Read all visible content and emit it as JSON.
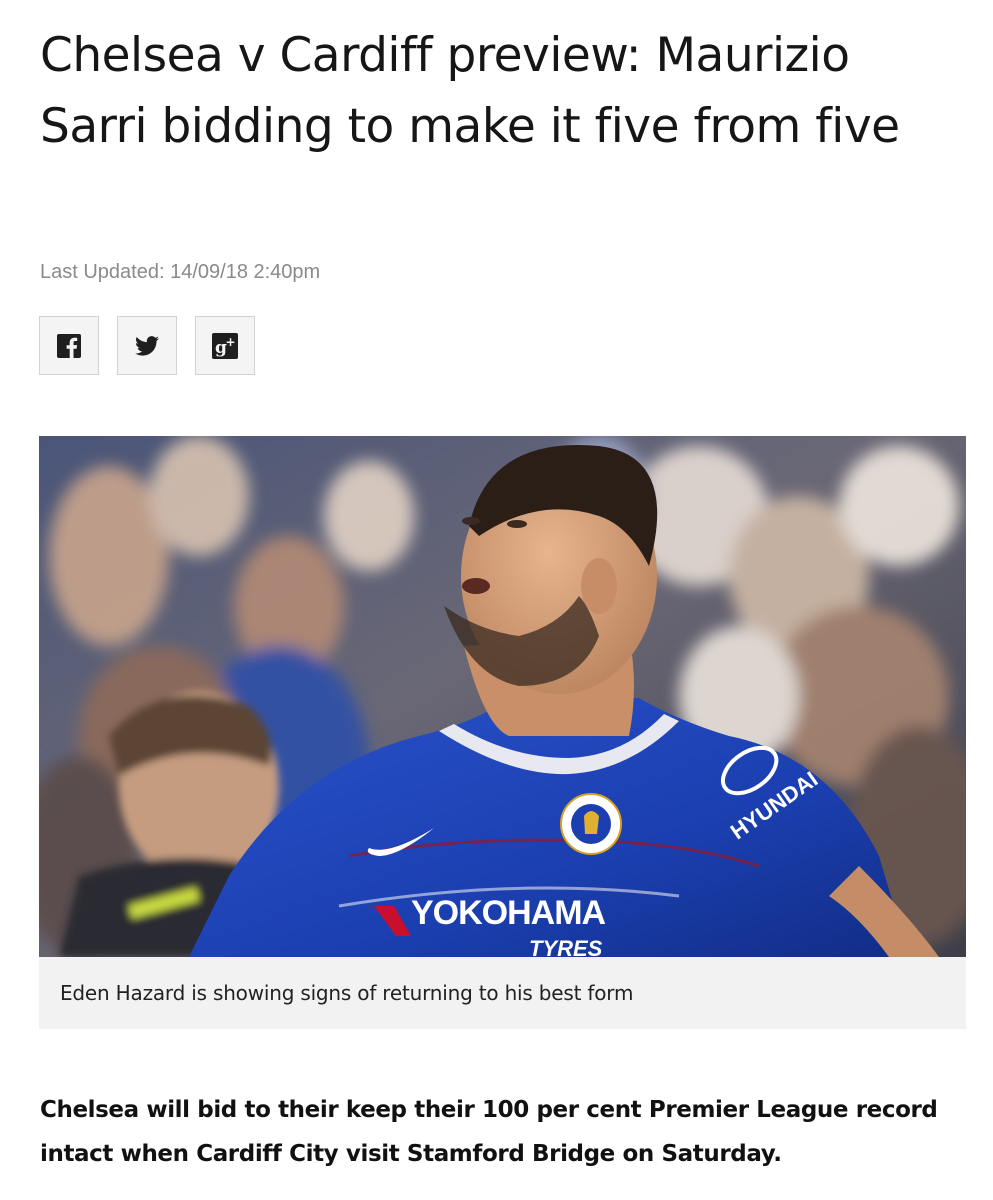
{
  "article": {
    "headline": "Chelsea v Cardiff preview: Maurizio Sarri bidding to make it five from five",
    "last_updated_label": "Last Updated: 14/09/18 2:40pm",
    "share": [
      {
        "name": "facebook",
        "icon": "facebook-icon"
      },
      {
        "name": "twitter",
        "icon": "twitter-icon"
      },
      {
        "name": "google-plus",
        "icon": "google-plus-icon"
      }
    ],
    "image": {
      "description_icon": "player-celebration-photo",
      "shirt_sponsor": "YOKOHAMA",
      "shirt_sponsor_sub": "TYRES",
      "sleeve_sponsor": "HYUNDAI"
    },
    "caption": "Eden Hazard is showing signs of returning to his best form",
    "standfirst": "Chelsea will bid to their keep their 100 per cent Premier League record intact when Cardiff City visit Stamford Bridge on Saturday."
  },
  "colors": {
    "headline": "#161616",
    "meta": "#8a8a8a",
    "share_bg": "#f4f4f4",
    "share_border": "#d2d2d2",
    "caption_bg": "#f2f2f2",
    "kit_blue": "#1b3fb0"
  }
}
